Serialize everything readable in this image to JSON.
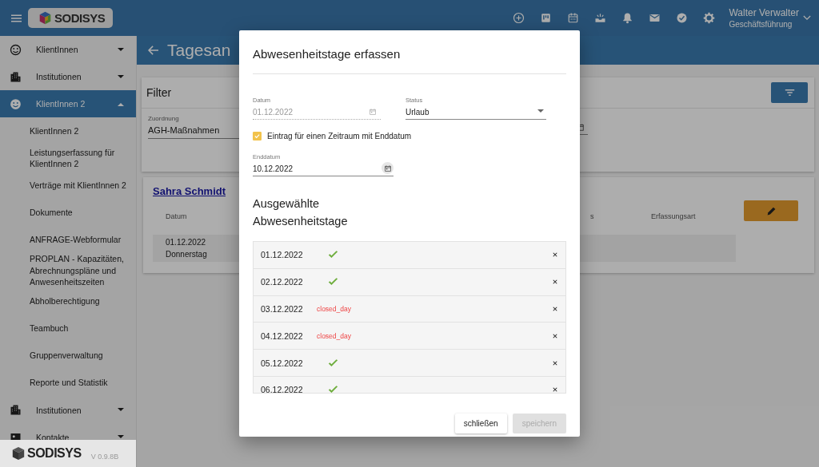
{
  "topbar": {
    "logo": "SODISYS",
    "user_name": "Walter Verwalter",
    "user_role": "Geschäftsführung"
  },
  "sidebar": {
    "items": [
      {
        "label": "KlientInnen",
        "expanded": false,
        "selected": false
      },
      {
        "label": "Institutionen",
        "expanded": false,
        "selected": false
      },
      {
        "label": "KlientInnen 2",
        "expanded": true,
        "selected": true,
        "children": [
          {
            "label": "KlientInnen 2"
          },
          {
            "label": "Leistungserfassung für KlientInnen 2"
          },
          {
            "label": "Verträge mit KlientInnen 2"
          },
          {
            "label": "Dokumente"
          },
          {
            "label": "ANFRAGE-Webformular"
          },
          {
            "label": "PROPLAN - Kapazitäten, Abrechnungspläne und Anwesenheitszeiten"
          },
          {
            "label": "Abholberechtigung"
          },
          {
            "label": "Teambuch"
          },
          {
            "label": "Gruppenverwaltung"
          },
          {
            "label": "Reporte und Statistik"
          }
        ]
      },
      {
        "label": "Institutionen",
        "expanded": false,
        "selected": false
      },
      {
        "label": "Kontakte",
        "expanded": false,
        "selected": false
      }
    ],
    "footer_logo": "SODISYS",
    "version": "V 0.9.8B"
  },
  "page": {
    "title": "Tagesan",
    "filter": {
      "title": "Filter",
      "fields": [
        {
          "label": "Zuordnung",
          "value": "AGH-Maßnahmen"
        }
      ]
    },
    "client": {
      "name": "Sahra Schmidt",
      "columns": [
        "Datum",
        "s",
        "Erfassungsart"
      ],
      "rows": [
        {
          "date": "01.12.2022",
          "weekday": "Donnerstag"
        }
      ]
    }
  },
  "dialog": {
    "title": "Abwesenheitstage erfassen",
    "date": {
      "label": "Datum",
      "value": "01.12.2022",
      "disabled": true
    },
    "status": {
      "label": "Status",
      "value": "Urlaub"
    },
    "period": {
      "label": "Eintrag für einen Zeitraum mit Enddatum",
      "checked": true
    },
    "end_date": {
      "label": "Enddatum",
      "value": "10.12.2022"
    },
    "list_title": "Ausgewählte Abwesenheitstage",
    "days": [
      {
        "date": "01.12.2022",
        "kind": "ok"
      },
      {
        "date": "02.12.2022",
        "kind": "ok"
      },
      {
        "date": "03.12.2022",
        "kind": "closed",
        "label": "closed_day"
      },
      {
        "date": "04.12.2022",
        "kind": "closed",
        "label": "closed_day"
      },
      {
        "date": "05.12.2022",
        "kind": "ok"
      },
      {
        "date": "06.12.2022",
        "kind": "ok"
      }
    ],
    "buttons": [
      {
        "label": "schließen",
        "disabled": false
      },
      {
        "label": "speichern",
        "disabled": true
      }
    ]
  }
}
